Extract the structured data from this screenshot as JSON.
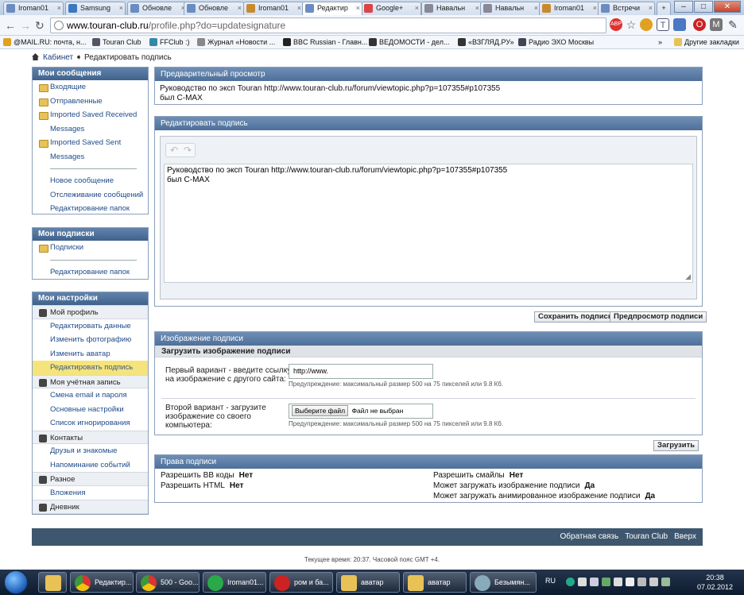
{
  "browser": {
    "tabs": [
      {
        "label": "Iroman01",
        "active": false
      },
      {
        "label": "Samsung",
        "active": false
      },
      {
        "label": "Обновле",
        "active": false
      },
      {
        "label": "Обновле",
        "active": false
      },
      {
        "label": "Iroman01",
        "active": false
      },
      {
        "label": "Редактир",
        "active": true
      },
      {
        "label": "Google+",
        "active": false
      },
      {
        "label": "Навальн",
        "active": false
      },
      {
        "label": "Навальн",
        "active": false
      },
      {
        "label": "Iroman01",
        "active": false
      },
      {
        "label": "Встречи",
        "active": false
      }
    ],
    "url_host": "www.touran-club.ru",
    "url_path": "/profile.php?do=updatesignature",
    "bookmarks": [
      "@MAIL.RU: почта, н...",
      "Touran Club",
      "FFClub :)",
      "Журнал «Новости ...",
      "BBC Russian - Главн...",
      "ВЕДОМОСТИ - дел...",
      "«ВЗГЛЯД.РУ»",
      "Радио ЭХО Москвы"
    ],
    "other_bookmarks": "Другие закладки",
    "more": "»"
  },
  "page": {
    "breadcrumb": {
      "home": "Кабинет",
      "current": "Редактировать подпись"
    },
    "sidebar": {
      "messages": {
        "title": "Мои сообщения",
        "folders": [
          "Входящие",
          "Отправленные",
          "Imported Saved Received Messages",
          "Imported Saved Sent Messages"
        ],
        "links": [
          "Новое сообщение",
          "Отслеживание сообщений",
          "Редактирование папок"
        ]
      },
      "subscriptions": {
        "title": "Мои подписки",
        "folders": [
          "Подписки"
        ],
        "links": [
          "Редактирование папок"
        ]
      },
      "settings": {
        "title": "Мои настройки",
        "profile_group": "Мой профиль",
        "profile_links": [
          "Редактировать данные",
          "Изменить фотографию",
          "Изменить аватар",
          "Редактировать подпись"
        ],
        "account_group": "Моя учётная запись",
        "account_links": [
          "Смена email и пароля",
          "Основные настройки",
          "Список игнорирования"
        ],
        "contacts_group": "Контакты",
        "contacts_links": [
          "Друзья и знакомые",
          "Напоминание событий"
        ],
        "misc_group": "Разное",
        "misc_links": [
          "Вложения"
        ],
        "diary_group": "Дневник"
      }
    },
    "preview": {
      "title": "Предварительный просмотр",
      "line1": "Руководство по эксп Touran http://www.touran-club.ru/forum/viewtopic.php?p=107355#p107355",
      "line2": "был C-MAX"
    },
    "edit": {
      "title": "Редактировать подпись",
      "line1": "Руководство по эксп Touran http://www.touran-club.ru/forum/viewtopic.php?p=107355#p107355",
      "line2": "был C-MAX",
      "save_label": "Сохранить подпись",
      "preview_label": "Предпросмотр подписи"
    },
    "image": {
      "title": "Изображение подписи",
      "subtitle": "Загрузить изображение подписи",
      "option1_label": "Первый вариант - введите ссылку на изображение с другого сайта:",
      "option1_value": "http://www.",
      "option2_label": "Второй вариант - загрузите изображение со своего компьютера:",
      "choose_file": "Выберите файл",
      "no_file": "Файл не выбран",
      "hint": "Предупреждение: максимальный размер 500 на 75 пикселей или 9.8 Кб.",
      "upload_label": "Загрузить"
    },
    "rights": {
      "title": "Права подписи",
      "left": [
        {
          "label": "Разрешить BB коды",
          "value": "Нет"
        },
        {
          "label": "Разрешить HTML",
          "value": "Нет"
        }
      ],
      "right": [
        {
          "label": "Разрешить смайлы",
          "value": "Нет"
        },
        {
          "label": "Может загружать изображение подписи",
          "value": "Да"
        },
        {
          "label": "Может загружать анимированное изображение подписи",
          "value": "Да"
        }
      ]
    },
    "footer": {
      "links": [
        "Обратная связь",
        "Touran Club",
        "Вверх"
      ]
    },
    "timeline": "Текущее время: 20:37. Часовой пояс GMT +4."
  },
  "taskbar": {
    "items": [
      "Редактир...",
      "500 - Goo...",
      "Iroman01...",
      "ром и ба...",
      "аватар",
      "аватар",
      "Безымян..."
    ],
    "lang": "RU",
    "time": "20:38",
    "date": "07.02.2012"
  },
  "colors": {
    "accent": "#4d6f99",
    "sidebar_active": "#f5e47c",
    "footer": "#3e576f"
  }
}
